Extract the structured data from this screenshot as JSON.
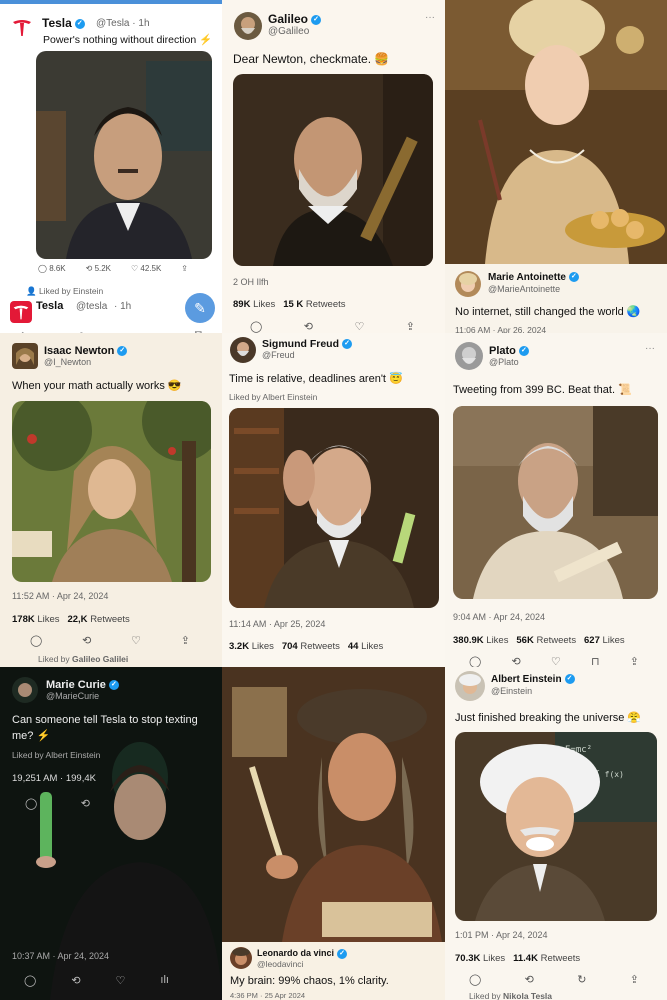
{
  "tesla": {
    "name": "Tesla",
    "handle": "@Tesla · 1h",
    "text": "Power's nothing without direction ⚡",
    "replies": "8.6K",
    "retweets": "5.2K",
    "likes": "42.5K",
    "liked_by": "Liked by Einstein",
    "repost_name": "Tesla",
    "repost_handle": "@tesla",
    "repost_time": "· 1h"
  },
  "galileo": {
    "name": "Galileo",
    "handle": "@Galileo",
    "text": "Dear Newton, checkmate. 🍔",
    "time": "2 OH Ilfh",
    "likes": "89K",
    "likes_label": "Likes",
    "retweets": "15 K",
    "retweets_label": "Retweets"
  },
  "antoinette": {
    "name": "Marie Antoinette",
    "handle": "@MarieAntoinette",
    "text": "No internet, still changed the world 🌏",
    "time": "11:06 AM · Apr 26, 2024"
  },
  "newton": {
    "name": "Isaac Newton",
    "handle": "@I_Newton",
    "text": "When your math actually works 😎",
    "time": "11:52 AM · Apr 24, 2024",
    "likes": "178K",
    "likes_label": "Likes",
    "retweets": "22,K",
    "retweets_label": "Retweets",
    "liked_by_prefix": "Liked by",
    "liked_by_name": "Galileo Galilei"
  },
  "freud": {
    "name": "Sigmund Freud",
    "handle": "@Freud",
    "text": "Time is relative, deadlines aren't 😇",
    "liked_by": "Liked by Albert Einstein",
    "time": "11:14 AM · Apr 25, 2024",
    "likes": "3.2K",
    "likes_label": "Likes",
    "retweets": "704",
    "retweets_label": "Retweets",
    "likes2": "44",
    "likes2_label": "Likes"
  },
  "plato": {
    "name": "Plato",
    "handle": "@Plato",
    "text": "Tweeting from 399 BC. Beat that. 📜",
    "time": "9:04 AM · Apr 24, 2024",
    "likes": "380.9K",
    "likes_label": "Likes",
    "retweets": "56K",
    "retweets_label": "Retweets",
    "likes2": "627",
    "likes2_label": "Likes"
  },
  "curie": {
    "name": "Marie Curie",
    "handle": "@MarieCurie",
    "text_line1": "Can someone tell Tesla to stop texting",
    "text_line2": "me? ⚡",
    "liked_by": "Liked by Albert Einstein",
    "stats": "19,251 AM · 199,4K",
    "time": "10:37 AM · Apr 24, 2024"
  },
  "davinci": {
    "name": "Leonardo da vinci",
    "handle": "@leodavinci",
    "text": "My brain: 99% chaos, 1% clarity.",
    "time": "4:36 PM · 25 Apr 2024"
  },
  "einstein": {
    "name": "Albert Einstein",
    "handle": "@Einstein",
    "text": "Just finished breaking the universe 😤",
    "time": "1:01 PM · Apr 24, 2024",
    "likes": "70.3K",
    "likes_label": "Likes",
    "retweets": "11.4K",
    "retweets_label": "Retweets",
    "liked_by_prefix": "Liked by",
    "liked_by_name": "Nikola Tesla"
  },
  "colors": {
    "accent": "#1d9bf0",
    "tesla_red": "#e31937",
    "paper": "#f7f1e8"
  }
}
